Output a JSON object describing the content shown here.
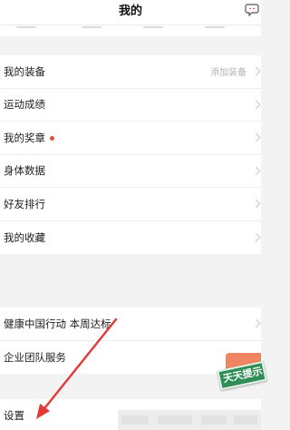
{
  "header": {
    "title": "我的"
  },
  "icons": {
    "chat": "chat-bubble-icon",
    "chevron": "chevron-right-icon"
  },
  "section1": [
    {
      "label": "我的装备",
      "value": "添加装备"
    },
    {
      "label": "运动成绩"
    },
    {
      "label": "我的奖章",
      "dot": true
    },
    {
      "label": "身体数据"
    },
    {
      "label": "好友排行"
    },
    {
      "label": "我的收藏"
    }
  ],
  "section2": [
    {
      "label": "健康中国行动 本周达标"
    },
    {
      "label": "企业团队服务"
    }
  ],
  "section3": [
    {
      "label": "设置"
    }
  ],
  "float_badge": {
    "text": "天天提示"
  },
  "colors": {
    "annotation_arrow": "#e53935",
    "badge_green": "#2f8d57",
    "badge_orange": "#f08360",
    "dot_red": "#e84b3c"
  }
}
